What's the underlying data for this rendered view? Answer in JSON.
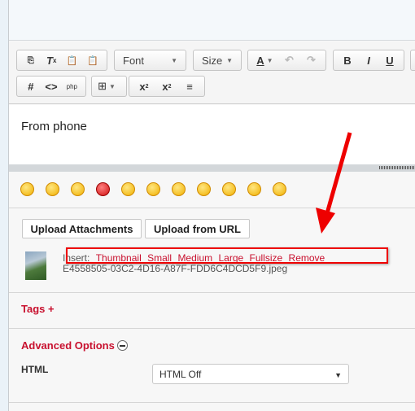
{
  "toolbar": {
    "font_label": "Font",
    "size_label": "Size",
    "text_color_label": "A",
    "bold_label": "B",
    "italic_label": "I",
    "underline_label": "U",
    "icons": [
      "source-icon",
      "remove-format-icon",
      "paste-text-icon",
      "paste-word-icon",
      "text-color-icon",
      "undo-icon",
      "redo-icon",
      "bold-icon",
      "italic-icon",
      "underline-icon",
      "hash-icon",
      "code-icon",
      "php-icon",
      "table-icon",
      "subscript-icon",
      "superscript-icon",
      "horizontal-rule-icon"
    ]
  },
  "editor": {
    "content": "From phone"
  },
  "smileys": [
    "smile",
    "tongue",
    "wink",
    "angry",
    "grin",
    "frown",
    "blush",
    "annoyed",
    "rolleyes",
    "cool",
    "surprised"
  ],
  "attachments": {
    "upload_label": "Upload Attachments",
    "upload_url_label": "Upload from URL",
    "insert_label": "Insert:",
    "links": [
      "Thumbnail",
      "Small",
      "Medium",
      "Large",
      "Fullsize",
      "Remove"
    ],
    "filename": "E4558505-03C2-4D16-A87F-FDD6C4DCD5F9.jpeg"
  },
  "tags": {
    "label": "Tags +"
  },
  "advanced": {
    "label": "Advanced Options",
    "html_label": "HTML",
    "html_value": "HTML Off"
  },
  "colors": {
    "accent": "#c8102e",
    "annotation": "#ee0000"
  }
}
